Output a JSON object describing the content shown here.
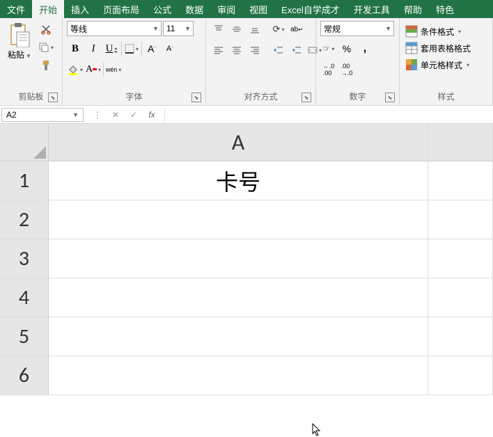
{
  "tabs": [
    "文件",
    "开始",
    "插入",
    "页面布局",
    "公式",
    "数据",
    "审阅",
    "视图",
    "Excel自学成才",
    "开发工具",
    "帮助",
    "特色"
  ],
  "active_tab_index": 1,
  "clipboard": {
    "paste": "粘贴",
    "label": "剪贴板"
  },
  "font": {
    "name": "等线",
    "size": "11",
    "bold": "B",
    "italic": "I",
    "underline": "U",
    "phonetic": "wén",
    "label": "字体"
  },
  "align": {
    "wrap": "ab",
    "label": "对齐方式"
  },
  "number": {
    "format": "常规",
    "label": "数字",
    "dec_inc": ".0",
    "dec_dec": ".00"
  },
  "styles": {
    "conditional": "条件格式",
    "table": "套用表格格式",
    "cell": "单元格样式",
    "label": "样式"
  },
  "name_box": "A2",
  "fx": "fx",
  "formula_value": "",
  "sheet": {
    "col": "A",
    "rows": [
      "1",
      "2",
      "3",
      "4",
      "5",
      "6"
    ],
    "cells": {
      "A1": "卡号"
    }
  }
}
